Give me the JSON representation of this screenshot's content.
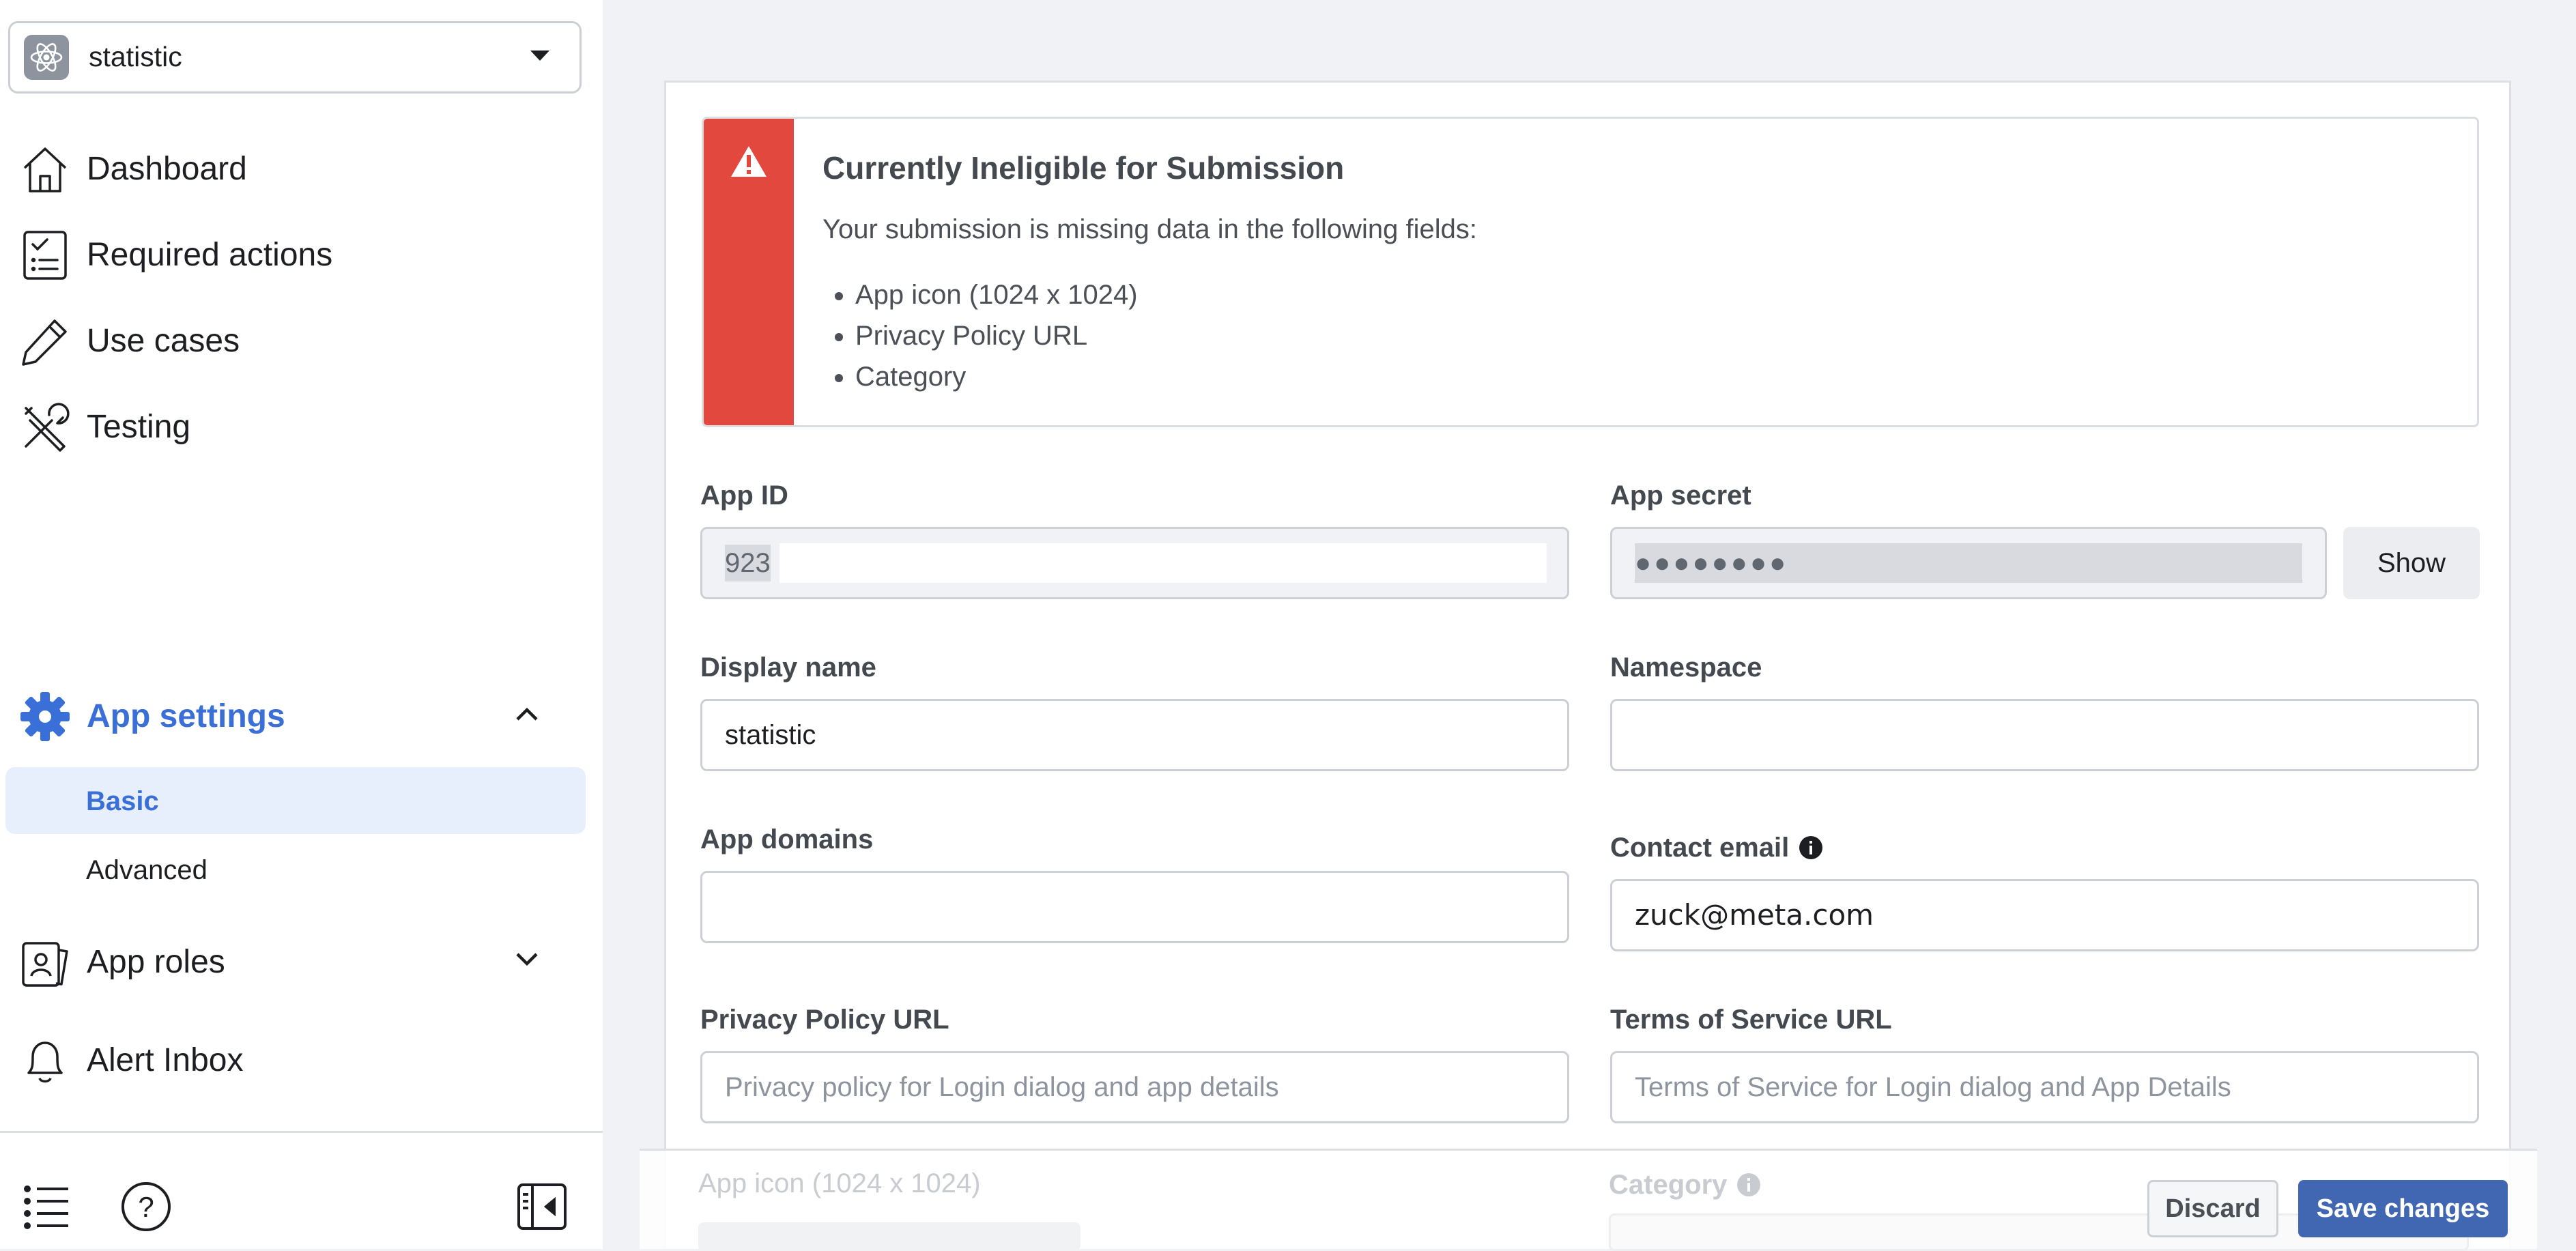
{
  "app_selector": {
    "name": "statistic",
    "icon": "atom-icon"
  },
  "nav": {
    "dashboard": "Dashboard",
    "required_actions": "Required actions",
    "use_cases": "Use cases",
    "testing": "Testing",
    "app_settings": "App settings",
    "basic": "Basic",
    "advanced": "Advanced",
    "app_roles": "App roles",
    "alert_inbox": "Alert Inbox"
  },
  "alert": {
    "title": "Currently Ineligible for Submission",
    "description": "Your submission is missing data in the following fields:",
    "missing": [
      "App icon (1024 x 1024)",
      "Privacy Policy URL",
      "Category"
    ]
  },
  "form": {
    "app_id": {
      "label": "App ID",
      "value": "923"
    },
    "app_secret": {
      "label": "App secret",
      "value": "●●●●●●●●",
      "show_label": "Show"
    },
    "display_name": {
      "label": "Display name",
      "value": "statistic"
    },
    "namespace": {
      "label": "Namespace",
      "value": ""
    },
    "app_domains": {
      "label": "App domains",
      "value": ""
    },
    "contact_email": {
      "label": "Contact email",
      "value": "zuck@meta.com"
    },
    "privacy_policy_url": {
      "label": "Privacy Policy URL",
      "placeholder": "Privacy policy for Login dialog and app details"
    },
    "terms_of_service_url": {
      "label": "Terms of Service URL",
      "placeholder": "Terms of Service for Login dialog and App Details"
    },
    "app_icon": {
      "label": "App icon (1024 x 1024)"
    },
    "category": {
      "label": "Category"
    }
  },
  "actions": {
    "discard": "Discard",
    "save": "Save changes"
  },
  "colors": {
    "accent": "#3a6fd8",
    "alert_red": "#e2483d",
    "save_blue": "#4267b2",
    "active_bg": "#e7effd"
  }
}
